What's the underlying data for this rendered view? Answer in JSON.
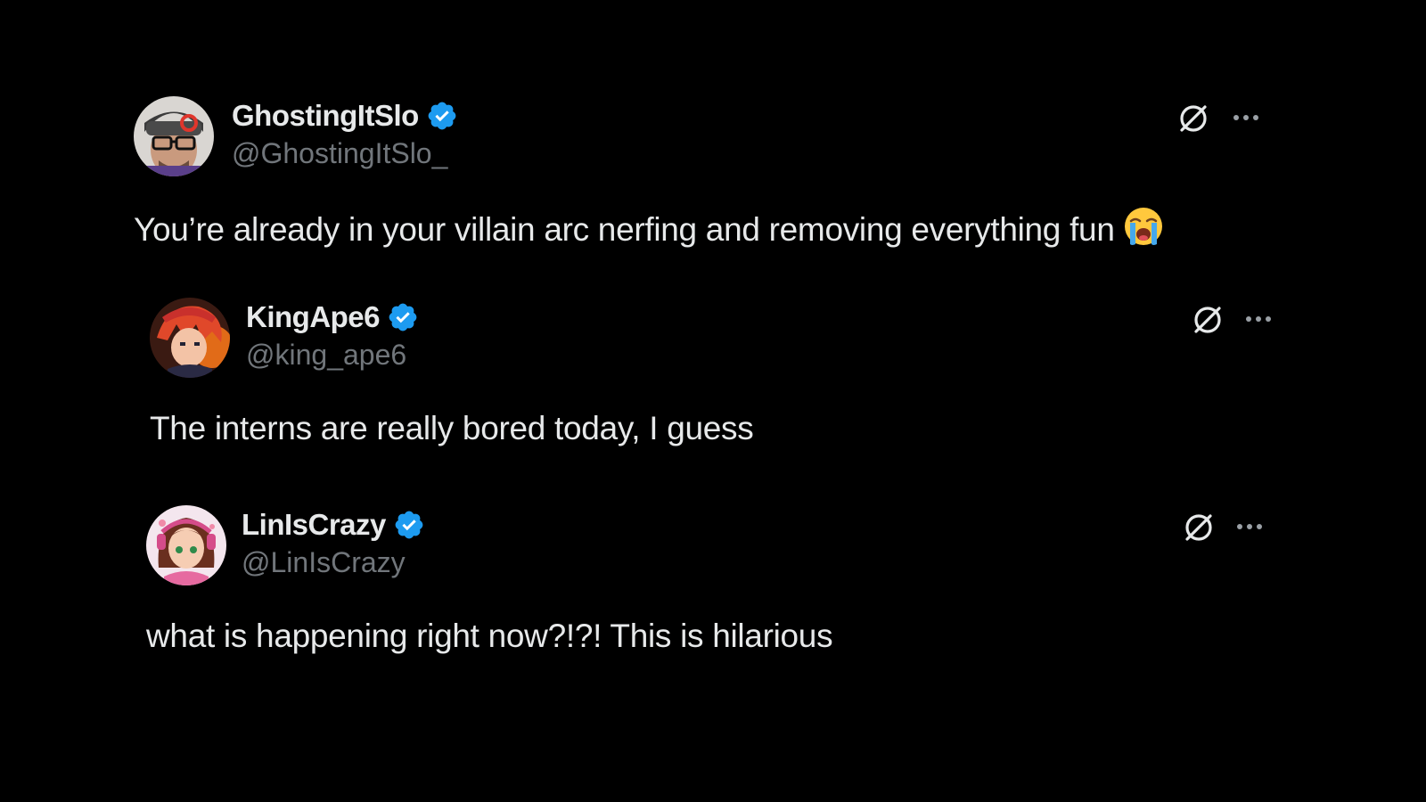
{
  "posts": [
    {
      "display_name": "GhostingItSlo",
      "handle": "@GhostingItSlo_",
      "text": "You’re already in your villain arc nerfing and removing everything fun",
      "emoji": "loudly-crying-face",
      "verified": true
    },
    {
      "display_name": "KingApe6",
      "handle": "@king_ape6",
      "text": "The interns are really bored today, I guess",
      "verified": true
    },
    {
      "display_name": "LinIsCrazy",
      "handle": "@LinIsCrazy",
      "text": "what is happening right now?!?! This is hilarious",
      "verified": true
    }
  ],
  "colors": {
    "background": "#000000",
    "text": "#e7e9ea",
    "handle": "#71767b",
    "verified": "#1d9bf0"
  },
  "icons": {
    "verified": "verified-badge-icon",
    "grok": "grok-icon",
    "more": "more-options-icon"
  }
}
